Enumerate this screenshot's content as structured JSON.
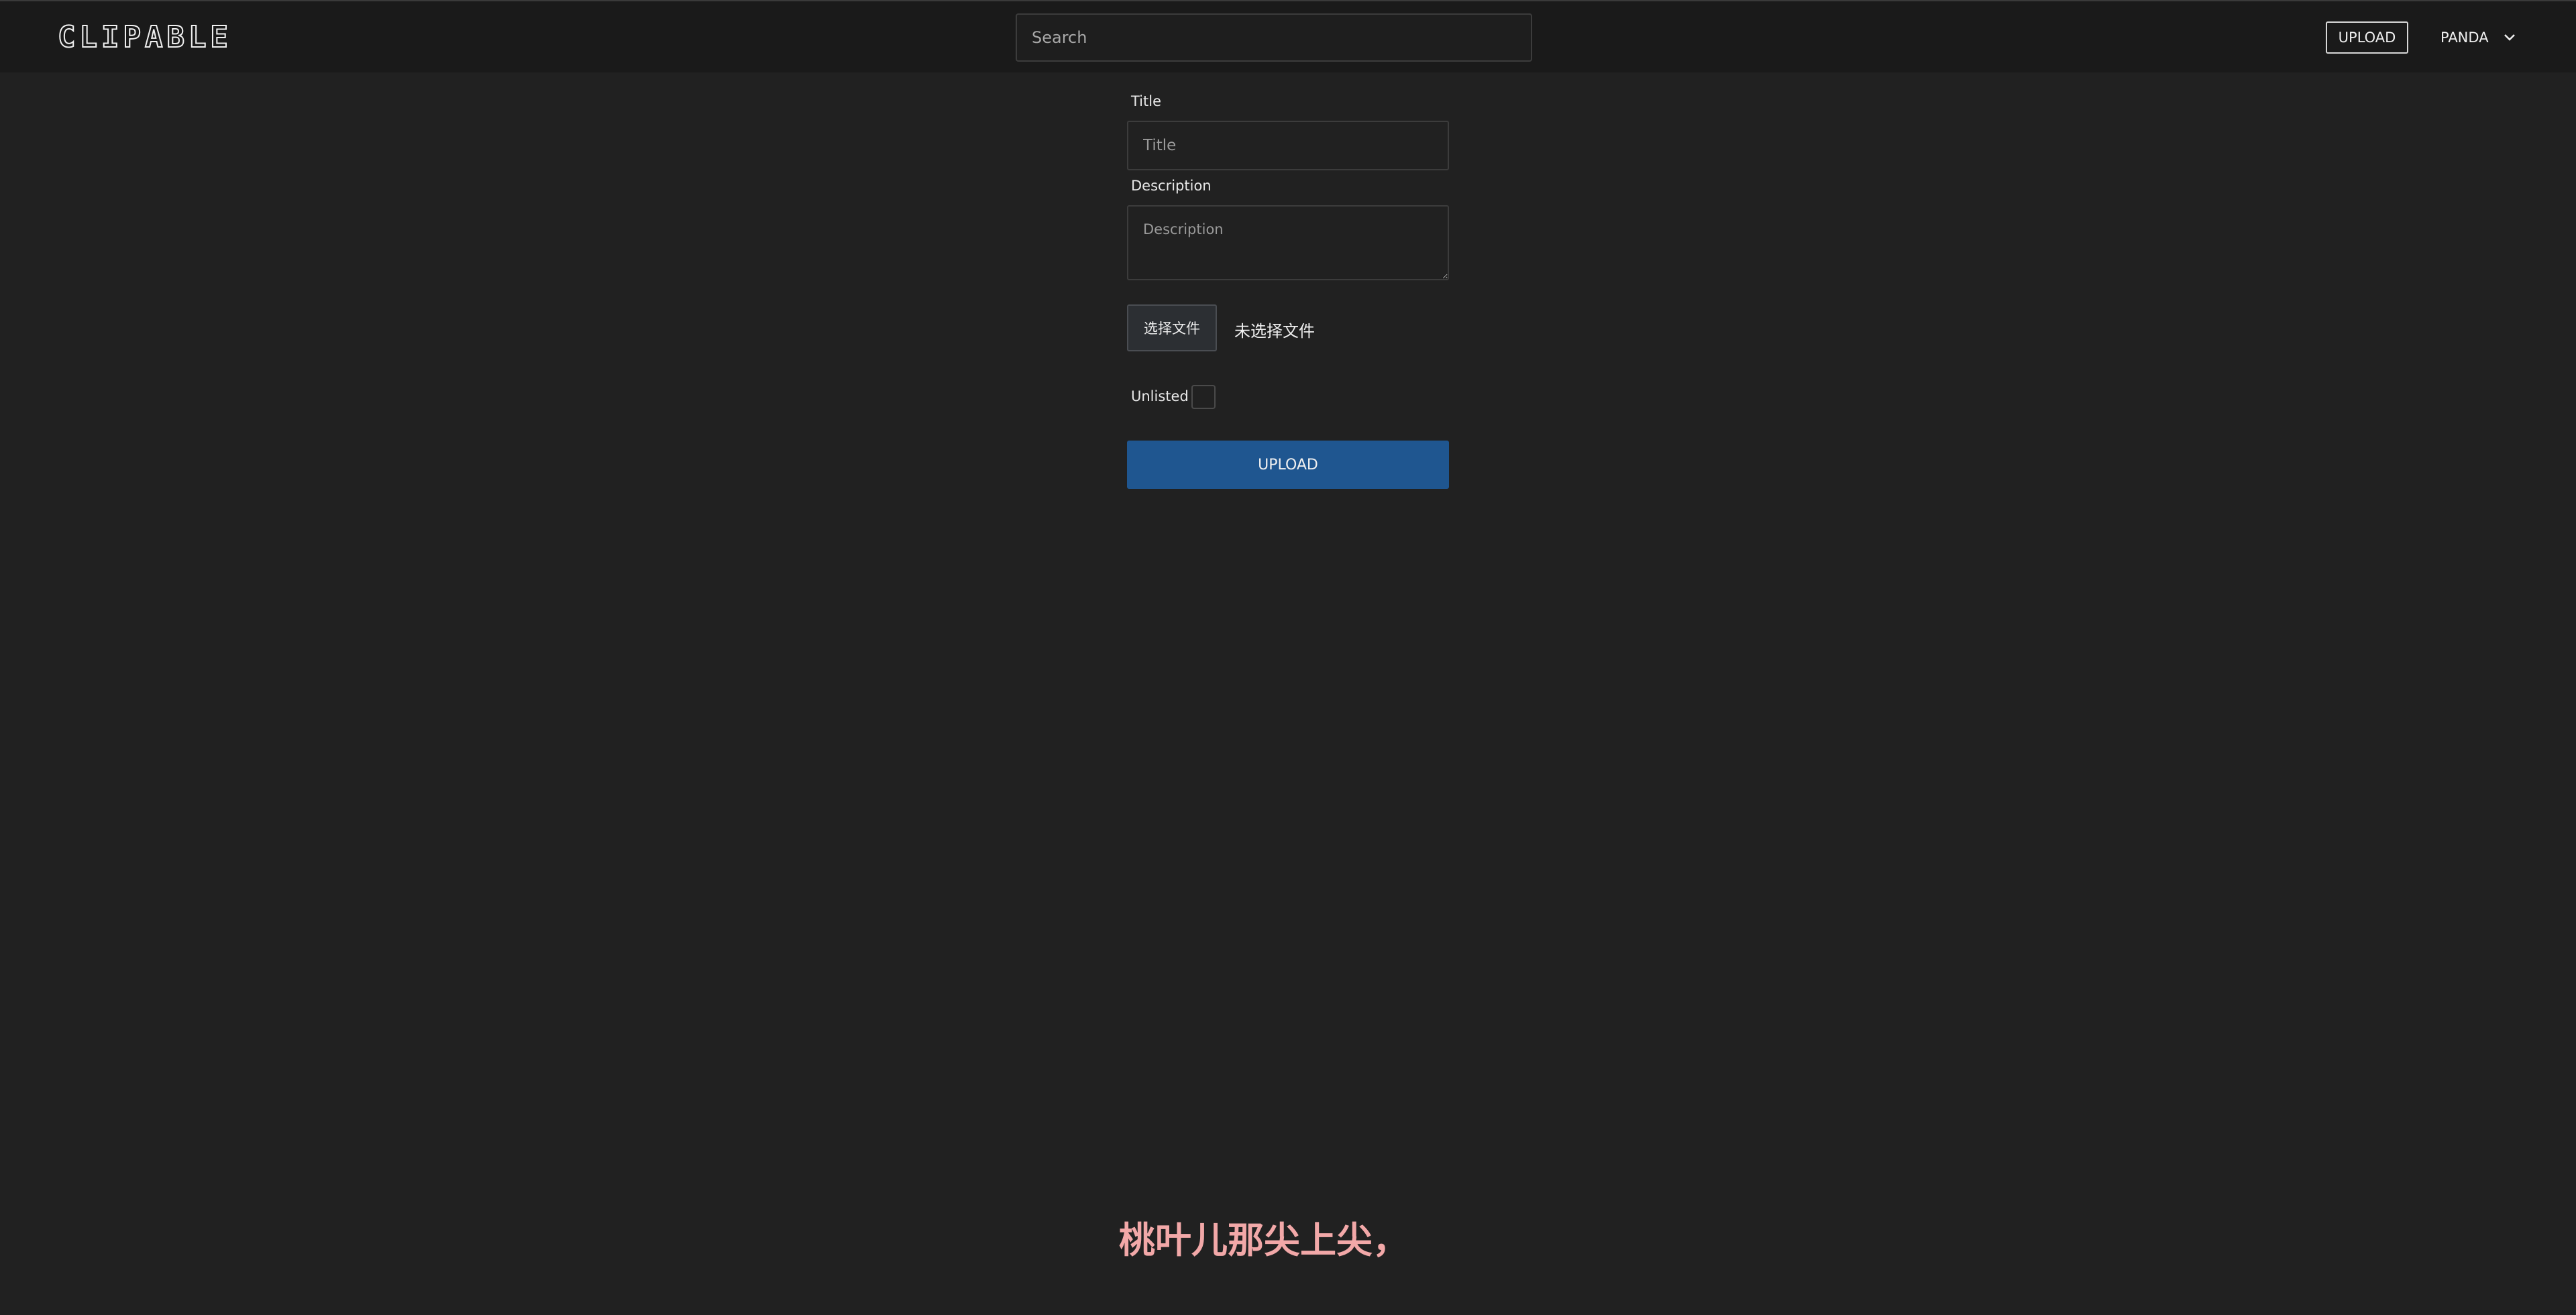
{
  "navbar": {
    "logo": "CLIPABLE",
    "search_placeholder": "Search",
    "upload_label": "UPLOAD",
    "user_label": "PANDA",
    "user_menu_icon": "chevron-down-icon"
  },
  "form": {
    "title_label": "Title",
    "title_placeholder": "Title",
    "description_label": "Description",
    "description_placeholder": "Description",
    "file_button_label": "选择文件",
    "file_status": "未选择文件",
    "unlisted_label": "Unlisted",
    "unlisted_checked": false,
    "submit_label": "UPLOAD"
  },
  "overlay": {
    "subtitle": "桃叶儿那尖上尖，"
  },
  "colors": {
    "background": "#212121",
    "navbar": "#1a1a1a",
    "primary_button": "#1f5690",
    "subtitle": "#f2a8a8"
  }
}
